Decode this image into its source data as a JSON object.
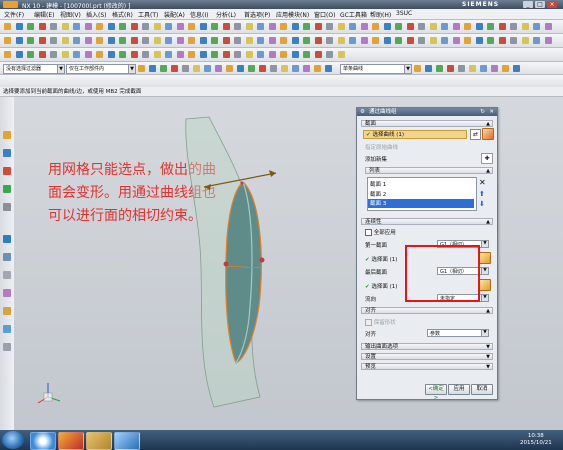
{
  "window": {
    "title": "NX 10 - 建模 - [100700l.prt  (修改的) ]",
    "brand": "SIEMENS",
    "controls": [
      "_",
      "□",
      "×"
    ]
  },
  "menubar": [
    "文件(F)",
    "编辑(E)",
    "视图(V)",
    "插入(S)",
    "格式(R)",
    "工具(T)",
    "装配(A)",
    "信息(I)",
    "分析(L)",
    "首选项(P)",
    "应用模块(N)",
    "窗口(O)",
    "GC工具箱",
    "帮助(H)",
    "3SUC"
  ],
  "selection_bar": {
    "filter": "没有选择过滤器",
    "scope": "仅在工作部件内",
    "curve_rule": "单条曲线"
  },
  "status": "选择要添加到当前截面的曲线/边，或使用 MB2 完成截面",
  "note": "用网格只能选点，做出的曲面会变形。用通过曲线组也可以进行面的相切约束。",
  "dialog": {
    "title": "通过曲线组",
    "sections": {
      "sections_label": "截面",
      "select_curve": "选择曲线 (1)",
      "point_specify": "指定原始曲线",
      "add_new_set": "添加新集",
      "list_label": "列表",
      "list_items": [
        "截面 1",
        "截面 2",
        "截面 3"
      ],
      "continuity_label": "连续性",
      "apply_all": "全部应用",
      "first_section": "第一截面",
      "first_value": "G1（相切）",
      "select_face_1": "选择面 (1)",
      "last_section": "最后截面",
      "last_value": "G1（相切）",
      "select_face_2": "选择面 (1)",
      "flow_direction": "流向",
      "flow_value": "未指定",
      "alignment_label": "对齐",
      "preserve_shape": "保留形状",
      "align_label": "对齐",
      "align_value": "参数",
      "output_surface": "输出曲面选项",
      "settings": "设置",
      "preview": "预览",
      "ok": "<确定>",
      "apply": "应用",
      "cancel": "取消"
    }
  },
  "taskbar": {
    "time": "10:38",
    "date": "2015/10/21"
  }
}
